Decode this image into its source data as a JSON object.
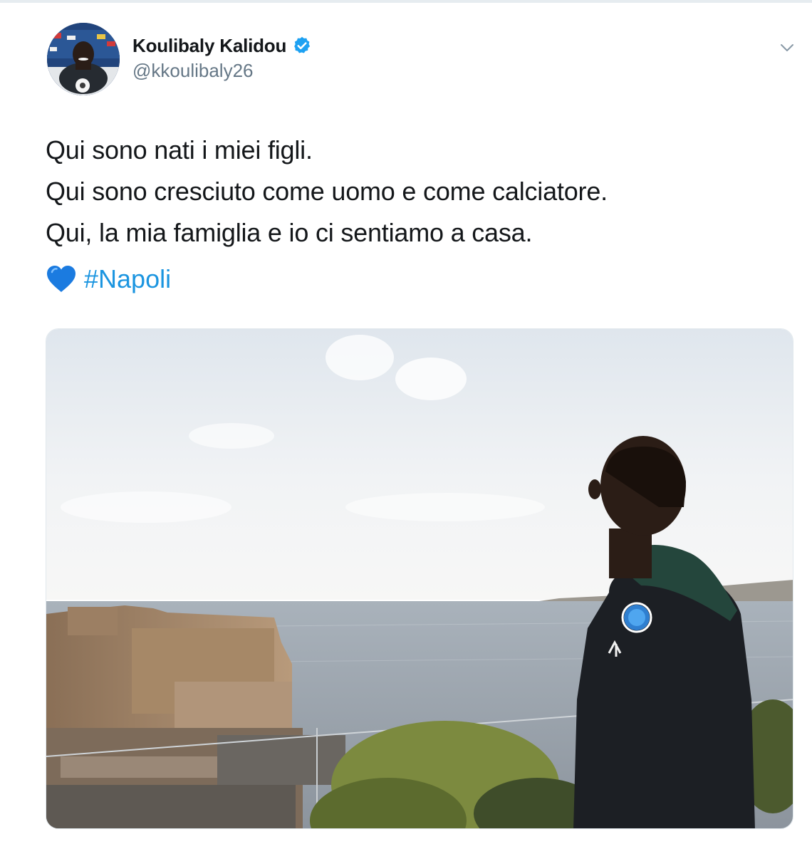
{
  "tweet": {
    "author": {
      "display_name": "Koulibaly Kalidou",
      "handle": "@kkoulibaly26",
      "verified": true,
      "verified_icon": "verified-badge-icon",
      "verified_color": "#1da1f2"
    },
    "menu_icon": "chevron-down-icon",
    "text_lines": [
      "Qui sono nati i miei figli.",
      "Qui sono cresciuto come uomo e come calciatore.",
      "Qui, la mia famiglia e io ci sentiamo a casa."
    ],
    "emoji": "blue-heart-icon",
    "hashtag": "#Napoli",
    "hashtag_color": "#1b95e0",
    "media": {
      "type": "photo",
      "subject_icon": "photo-player-overlooking-gulf-of-naples"
    }
  }
}
